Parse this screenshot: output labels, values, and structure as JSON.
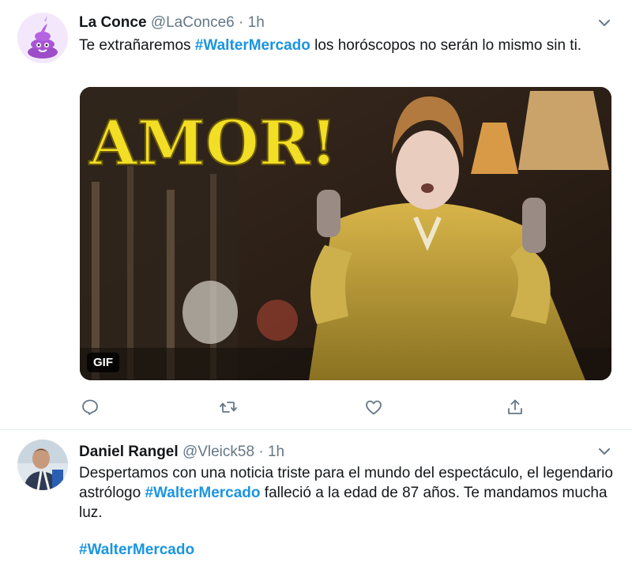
{
  "tweets": [
    {
      "name": "La Conce",
      "handle": "@LaConce6",
      "dot": "·",
      "time": "1h",
      "text_before": "Te extrañaremos ",
      "hashtag": "#WalterMercado",
      "text_after": " los horóscopos no serán lo mismo sin ti.",
      "media": {
        "overlay_text": "AMOR!",
        "badge": "GIF"
      },
      "actions": [
        "reply-icon",
        "retweet-icon",
        "like-icon",
        "share-icon"
      ]
    },
    {
      "name": "Daniel Rangel",
      "handle": "@Vleick58",
      "dot": "·",
      "time": "1h",
      "text_before": "Despertamos con una noticia triste para el mundo del espectáculo, el legendario astrólogo ",
      "hashtag": "#WalterMercado",
      "text_after": " falleció a la edad de 87 años. Te mandamos mucha luz.",
      "footer_hashtag": "#WalterMercado"
    }
  ],
  "colors": {
    "link": "#1b95e0",
    "muted": "#657786",
    "text": "#14171a"
  }
}
